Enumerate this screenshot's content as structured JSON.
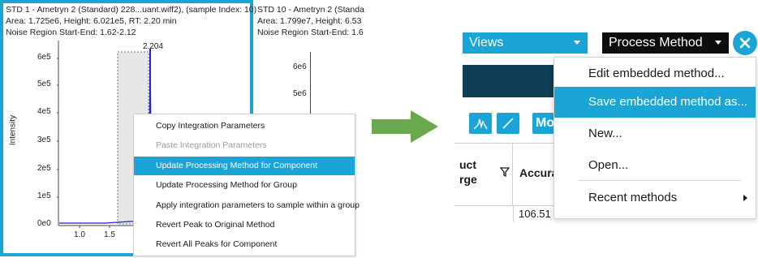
{
  "left_panel": {
    "chart1": {
      "line1": "STD 1 - Ametryn 2 (Standard) 228...uant.wiff2), (sample Index: 10)",
      "line2": "Area: 1.725e6, Height: 6.021e5, RT: 2.20 min",
      "line3": "Noise Region Start-End: 1.62-2.12",
      "peak_label": "2.204",
      "ylabel": "Intensity",
      "yticks": [
        "6e5",
        "5e5",
        "4e5",
        "3e5",
        "2e5",
        "1e5",
        "0e0"
      ],
      "xticks": [
        "1.0",
        "1.5"
      ]
    },
    "chart2": {
      "line1": "STD 10 - Ametryn 2 (Standa",
      "line2": "Area: 1.799e7, Height: 6.53",
      "line3": "Noise Region Start-End: 1.6",
      "yticks": [
        "6e6",
        "5e6"
      ]
    },
    "context_menu": [
      {
        "label": "Copy Integration Parameters",
        "state": "normal"
      },
      {
        "label": "Paste Integration Parameters",
        "state": "disabled"
      },
      {
        "label": "Update Processing Method for Component",
        "state": "highlighted"
      },
      {
        "label": "Update Processing Method for Group",
        "state": "normal"
      },
      {
        "label": "Apply integration parameters to sample within a group",
        "state": "normal"
      },
      {
        "label": "Revert Peak to Original Method",
        "state": "normal"
      },
      {
        "label": "Revert All Peaks for Component",
        "state": "normal"
      }
    ]
  },
  "right_panel": {
    "views_label": "Views",
    "process_method_label": "Process Method",
    "close_icon": "close-icon",
    "toolbar_text": "Mo",
    "col_header_1a": "uct",
    "col_header_1b": "rge",
    "col_header_2": "Accura",
    "cell_value": "106.51",
    "menu": {
      "edit": "Edit embedded method...",
      "save": "Save embedded method as...",
      "new": "New...",
      "open": "Open...",
      "recent": "Recent methods"
    }
  },
  "colors": {
    "accent_blue": "#1aa5d6",
    "dark_teal": "#0e3d55",
    "arrow_green": "#6aa84f",
    "peak_blue": "#1f1fd8"
  }
}
